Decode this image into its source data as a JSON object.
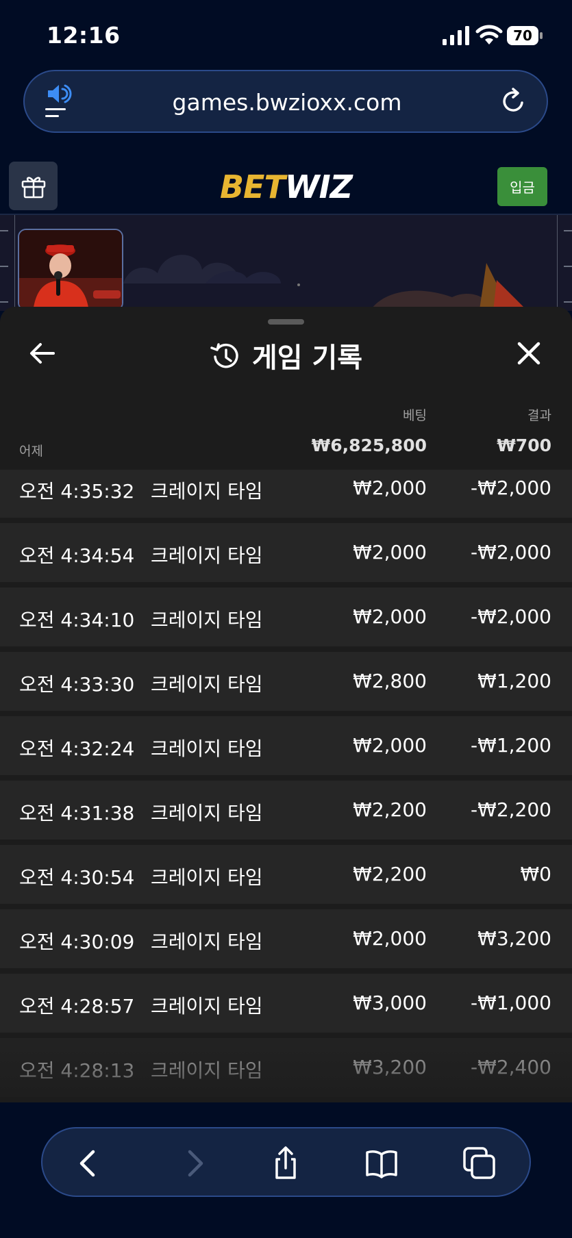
{
  "status_bar": {
    "time": "12:16",
    "battery": "70"
  },
  "browser": {
    "url": "games.bwzioxx.com"
  },
  "site_header": {
    "brand_part1": "BET",
    "brand_part2": "WIZ",
    "deposit_label": "입금"
  },
  "history": {
    "title": "게임 기록",
    "col_bet": "베팅",
    "col_result": "결과",
    "date_label": "어제",
    "total_bet": "₩6,825,800",
    "total_result": "₩700",
    "rows": [
      {
        "time": "오전 4:35:32",
        "game": "크레이지 타임",
        "bet": "₩2,000",
        "result": "-₩2,000"
      },
      {
        "time": "오전 4:34:54",
        "game": "크레이지 타임",
        "bet": "₩2,000",
        "result": "-₩2,000"
      },
      {
        "time": "오전 4:34:10",
        "game": "크레이지 타임",
        "bet": "₩2,000",
        "result": "-₩2,000"
      },
      {
        "time": "오전 4:33:30",
        "game": "크레이지 타임",
        "bet": "₩2,800",
        "result": "₩1,200"
      },
      {
        "time": "오전 4:32:24",
        "game": "크레이지 타임",
        "bet": "₩2,000",
        "result": "-₩1,200"
      },
      {
        "time": "오전 4:31:38",
        "game": "크레이지 타임",
        "bet": "₩2,200",
        "result": "-₩2,200"
      },
      {
        "time": "오전 4:30:54",
        "game": "크레이지 타임",
        "bet": "₩2,200",
        "result": "₩0"
      },
      {
        "time": "오전 4:30:09",
        "game": "크레이지 타임",
        "bet": "₩2,000",
        "result": "₩3,200"
      },
      {
        "time": "오전 4:28:57",
        "game": "크레이지 타임",
        "bet": "₩3,000",
        "result": "-₩1,000"
      },
      {
        "time": "오전 4:28:13",
        "game": "크레이지 타임",
        "bet": "₩3,200",
        "result": "-₩2,400"
      }
    ]
  },
  "icons": {
    "back": "arrow-left-icon",
    "history": "history-clock-icon",
    "close": "close-icon",
    "gift": "gift-icon",
    "reload": "reload-icon",
    "audio": "speaker-icon",
    "toolbar": [
      "chevron-left-icon",
      "chevron-right-icon",
      "share-icon",
      "bookmarks-icon",
      "tabs-icon"
    ]
  },
  "colors": {
    "background": "#010c24",
    "brand_gold": "#e8b531",
    "deposit_green": "#3a8f3a",
    "sheet": "#1c1c1c",
    "row": "#262626",
    "url_bar": "#142443"
  }
}
